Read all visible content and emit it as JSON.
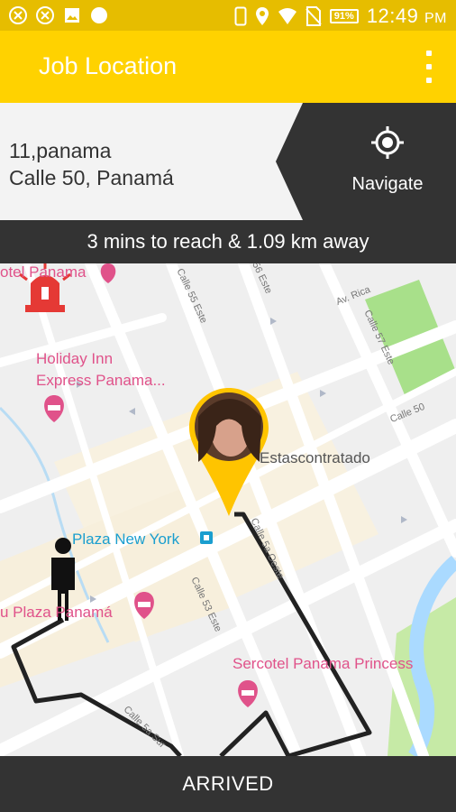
{
  "status_bar": {
    "time": "12:49",
    "period": "PM",
    "battery": "91%",
    "left_icons": [
      "app-notification-icon",
      "app-notification-icon",
      "image-icon",
      "circle-icon"
    ],
    "right_icons": [
      "phone-icon",
      "location-icon",
      "wifi-icon",
      "no-sim-icon",
      "battery-icon"
    ]
  },
  "app_bar": {
    "title": "Job Location",
    "menu_icon": "more-vert-icon"
  },
  "address": {
    "line1": "11,panama",
    "line2": "Calle 50, Panamá"
  },
  "navigate": {
    "label": "Navigate",
    "icon": "gps-crosshair-icon"
  },
  "distance_text": "3 mins to reach & 1.09 km away",
  "map": {
    "poi_labels": {
      "hotel_top": "otel Panama",
      "holiday_inn_1": "Holiday Inn",
      "holiday_inn_2": "Express Panama...",
      "plaza_new_york": "Plaza New York",
      "plaza_panama": "u Plaza Panamá",
      "sercotel": "Sercotel Panama Princess",
      "pin_user": "Estascontratado"
    },
    "road_labels": {
      "calle_55": "Calle 55 Este",
      "calle_56": "56 Este",
      "av_rica": "Av. Rica",
      "calle_57": "Calle 57 Este",
      "calle_50": "Calle 50",
      "calle_53": "Calle 53 Este",
      "calle_oeste": "Calle 5a Oeste",
      "calle_sur": "Calle 5a Sur"
    },
    "colors": {
      "accent": "#ffd200",
      "route": "#222222",
      "park": "#a8e08a",
      "water": "#aadaff"
    }
  },
  "bottom_action": "ARRIVED"
}
